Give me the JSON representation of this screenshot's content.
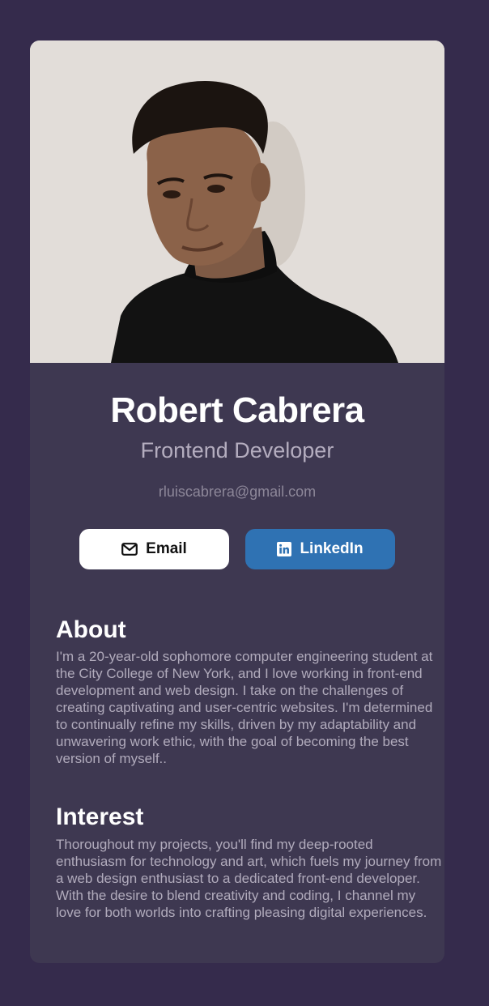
{
  "profile": {
    "name": "Robert Cabrera",
    "role": "Frontend Developer",
    "email": "rluiscabrera@gmail.com"
  },
  "buttons": {
    "email_label": "Email",
    "email_icon": "mail-icon",
    "linkedin_label": "LinkedIn",
    "linkedin_icon": "linkedin-icon"
  },
  "about": {
    "title": "About",
    "body": "I'm a 20-year-old sophomore computer engineering student at the City College of New York, and I love working in front-end development and web design. I take on the challenges of creating captivating and user-centric websites. I'm determined to continually refine my skills, driven by my adaptability and unwavering work ethic, with the goal of becoming the best version of myself.."
  },
  "interest": {
    "title": "Interest",
    "body": "Thoroughout my projects, you'll find my deep-rooted enthusiasm for technology and art, which fuels my journey from a web design enthusiast to a dedicated front-end developer. With the desire to blend creativity and coding, I channel my love for both worlds into crafting pleasing digital experiences."
  },
  "colors": {
    "page_background": "#352b4c",
    "card_background": "#3e3851",
    "linkedin_blue": "#2f72b3",
    "email_button": "#ffffff"
  }
}
